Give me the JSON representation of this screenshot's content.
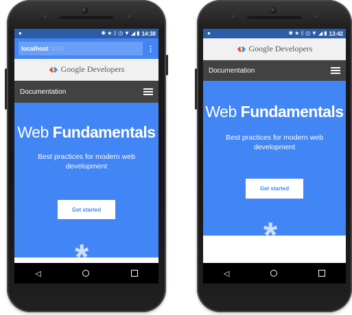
{
  "left": {
    "status": {
      "time": "14:38"
    },
    "url": {
      "host": "localhost",
      "port": ":3000"
    },
    "brand": "Google Developers",
    "nav": {
      "label": "Documentation"
    },
    "hero": {
      "title_light": "Web ",
      "title_bold": "Fundamentals",
      "subtitle": "Best practices for modern web development",
      "cta": "Get started"
    }
  },
  "right": {
    "status": {
      "time": "13:42"
    },
    "brand": "Google Developers",
    "nav": {
      "label": "Documentation"
    },
    "hero": {
      "title_light": "Web ",
      "title_bold": "Fundamentals",
      "subtitle": "Best practices for modern web development",
      "cta": "Get started"
    }
  },
  "icons": {
    "status": [
      "notification-icon",
      "bluetooth-icon",
      "star-icon",
      "vibrate-icon",
      "alarm-icon",
      "wifi-icon",
      "signal-icon",
      "battery-icon"
    ],
    "nav": [
      "back-icon",
      "home-icon",
      "recents-icon"
    ]
  },
  "colors": {
    "primary": "#4285f4",
    "status": "#2e5da8",
    "docbar": "#424242"
  }
}
